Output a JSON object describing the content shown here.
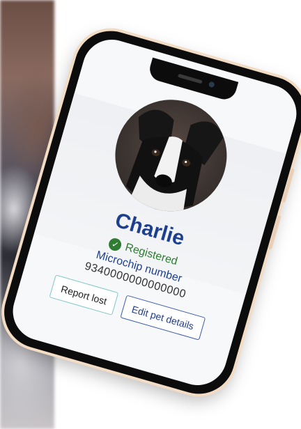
{
  "pet": {
    "name": "Charlie",
    "status": "Registered",
    "microchip_label": "Microchip number",
    "microchip_value": "9340000000000000"
  },
  "actions": {
    "report_lost": "Report lost",
    "edit_details": "Edit pet details"
  },
  "colors": {
    "name": "#1d3f8f",
    "registered": "#2e7d32",
    "report_border": "#7fc6c9",
    "edit_border": "#3a5bb0"
  },
  "icons": {
    "status": "check-circle-icon"
  }
}
